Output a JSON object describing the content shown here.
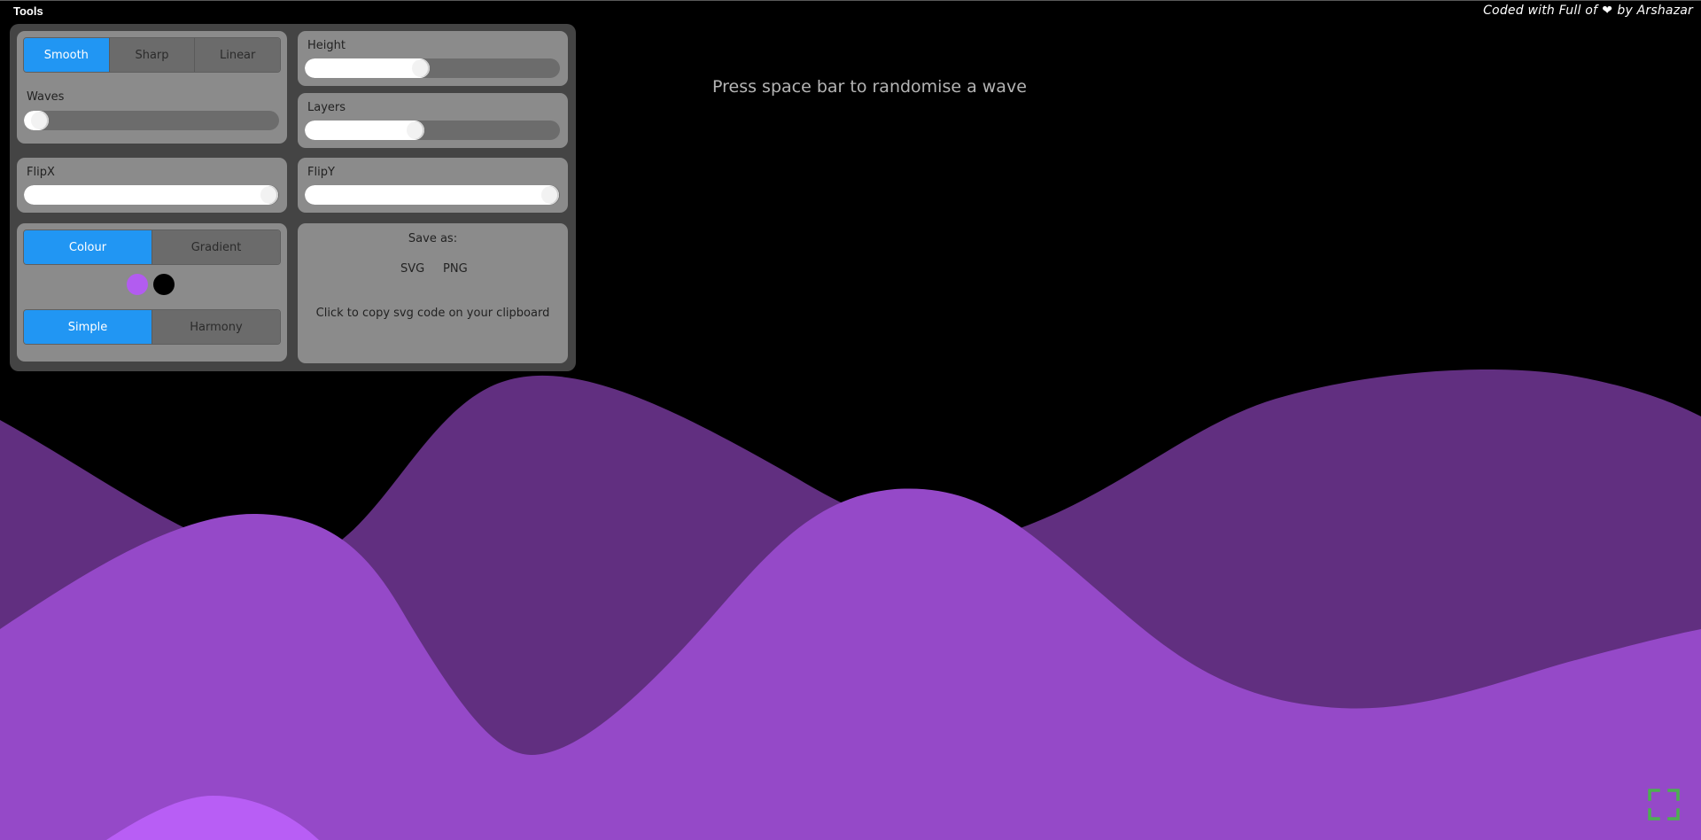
{
  "header": {
    "tools_title": "Tools",
    "credit_prefix": "Coded with Full of",
    "credit_suffix": "by Arshazar",
    "heart_icon": "heart-icon"
  },
  "hint": "Press space bar to randomise a wave",
  "curve": {
    "options": [
      "Smooth",
      "Sharp",
      "Linear"
    ],
    "selected": "Smooth"
  },
  "sliders": {
    "waves": {
      "label": "Waves",
      "value": 0.03
    },
    "height": {
      "label": "Height",
      "value": 0.45
    },
    "layers": {
      "label": "Layers",
      "value": 0.43
    },
    "flipx": {
      "label": "FlipX",
      "value": 1.0
    },
    "flipy": {
      "label": "FlipY",
      "value": 1.0
    }
  },
  "fill_mode": {
    "options": [
      "Colour",
      "Gradient"
    ],
    "selected": "Colour"
  },
  "colors": {
    "primary": "#b25cf0",
    "secondary": "#000000",
    "accent": "#2196f3",
    "wave_back": "#612f80",
    "wave_mid": "#9549c8",
    "wave_front": "#b85ef5"
  },
  "palette_mode": {
    "options": [
      "Simple",
      "Harmony"
    ],
    "selected": "Simple"
  },
  "save": {
    "title": "Save as:",
    "svg": "SVG",
    "png": "PNG",
    "copy_note": "Click to copy svg code on your clipboard"
  },
  "fullscreen_icon": "fullscreen-icon"
}
